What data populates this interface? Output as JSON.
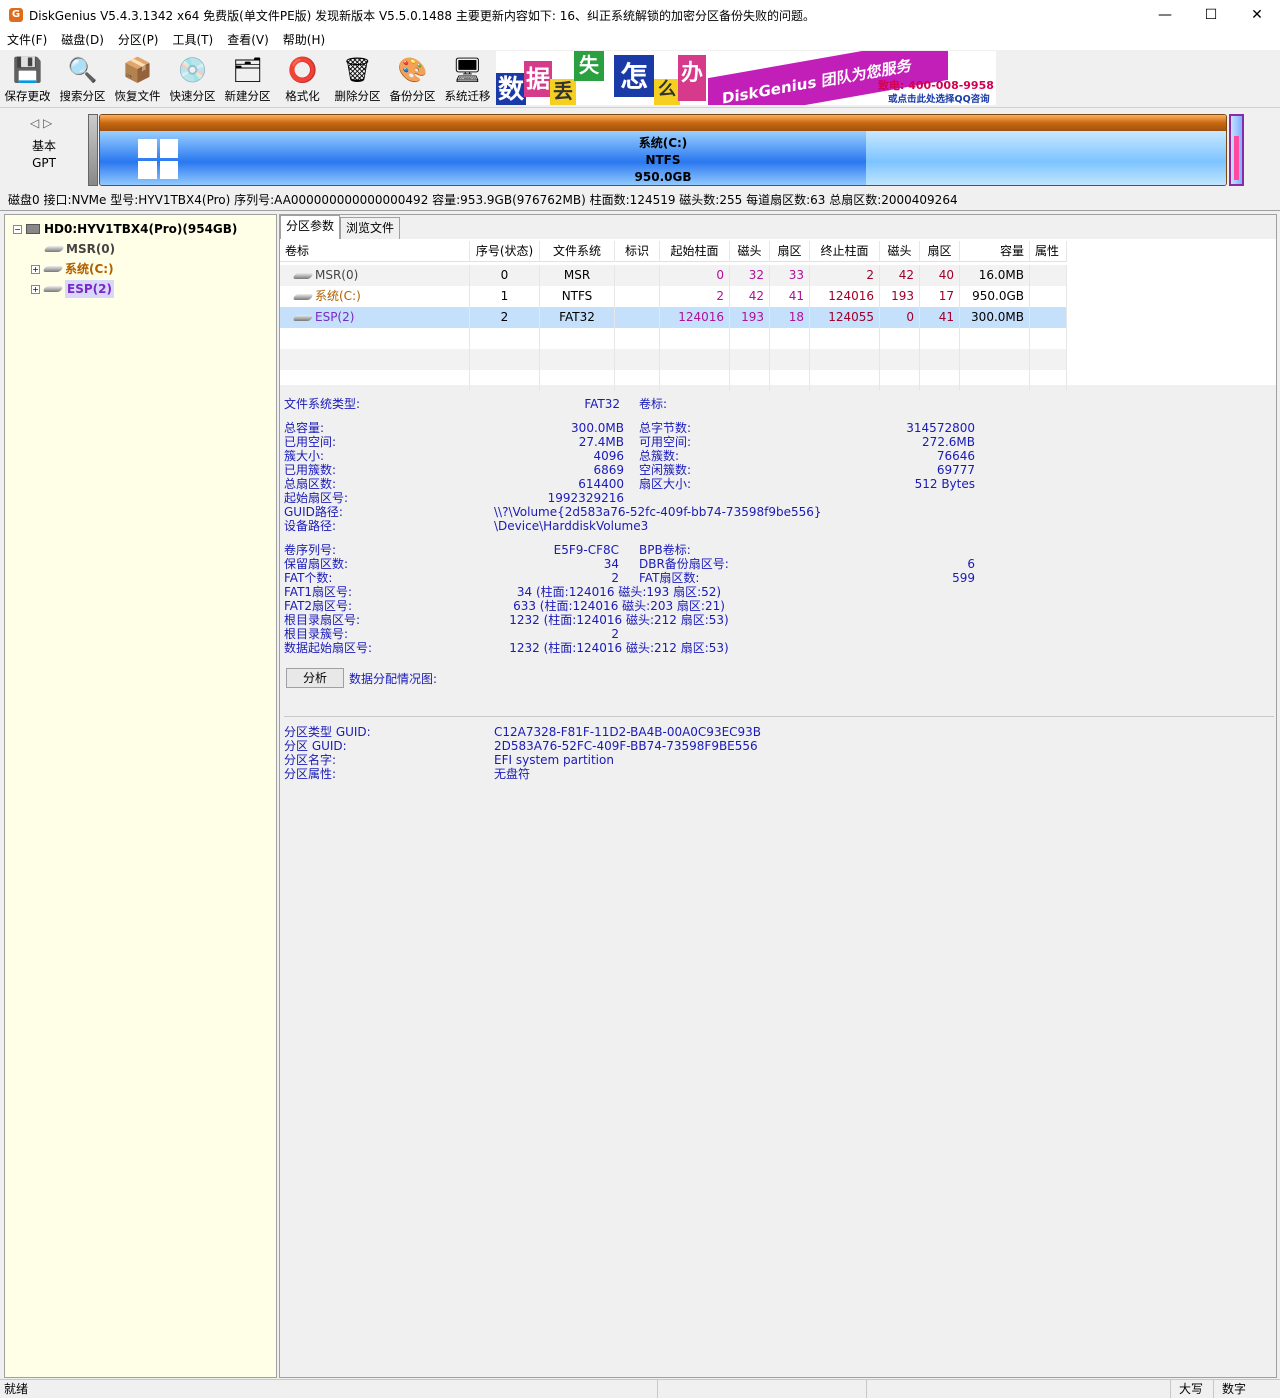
{
  "window": {
    "title": "DiskGenius V5.4.3.1342 x64 免费版(单文件PE版)   发现新版本 V5.5.0.1488    主要更新内容如下: 16、纠正系统解锁的加密分区备份失败的问题。",
    "app_icon": "G",
    "minimize": "—",
    "maximize": "☐",
    "close": "✕"
  },
  "menu": [
    "文件(F)",
    "磁盘(D)",
    "分区(P)",
    "工具(T)",
    "查看(V)",
    "帮助(H)"
  ],
  "toolbar": [
    {
      "label": "保存更改",
      "icon": "save-icon",
      "glyph": "💾"
    },
    {
      "label": "搜索分区",
      "icon": "search-icon",
      "glyph": "🔍"
    },
    {
      "label": "恢复文件",
      "icon": "recover-icon",
      "glyph": "📦"
    },
    {
      "label": "快速分区",
      "icon": "quick-partition-icon",
      "glyph": "💿"
    },
    {
      "label": "新建分区",
      "icon": "new-partition-icon",
      "glyph": "🗂"
    },
    {
      "label": "格式化",
      "icon": "format-icon",
      "glyph": "⭕"
    },
    {
      "label": "删除分区",
      "icon": "delete-icon",
      "glyph": "🗑"
    },
    {
      "label": "备份分区",
      "icon": "backup-icon",
      "glyph": "🎨"
    },
    {
      "label": "系统迁移",
      "icon": "migrate-icon",
      "glyph": "🖥"
    }
  ],
  "banner": {
    "chars": [
      "数",
      "据",
      "丢",
      "失",
      "怎",
      "么",
      "办"
    ],
    "slogan": "DiskGenius 团队为您服务",
    "phone": "致电: 400-008-9958",
    "qq": "或点击此处选择QQ咨询"
  },
  "disk_panel": {
    "nav": "◁ ▷",
    "type_line1": "基本",
    "type_line2": "GPT",
    "partition_name": "系统(C:)",
    "partition_fs": "NTFS",
    "partition_size": "950.0GB",
    "used_fraction": 0.68
  },
  "disk_info": "磁盘0 接口:NVMe  型号:HYV1TBX4(Pro)  序列号:AA000000000000000492  容量:953.9GB(976762MB)  柱面数:124519  磁头数:255  每道扇区数:63  总扇区数:2000409264",
  "tree": {
    "disk": "HD0:HYV1TBX4(Pro)(954GB)",
    "expander_minus": "−",
    "expander_plus": "+",
    "items": [
      "MSR(0)",
      "系统(C:)",
      "ESP(2)"
    ]
  },
  "tabs": [
    "分区参数",
    "浏览文件"
  ],
  "table": {
    "headers": [
      "卷标",
      "序号(状态)",
      "文件系统",
      "标识",
      "起始柱面",
      "磁头",
      "扇区",
      "终止柱面",
      "磁头",
      "扇区",
      "容量",
      "属性"
    ],
    "rows": [
      [
        "MSR(0)",
        "0",
        "MSR",
        "",
        "0",
        "32",
        "33",
        "2",
        "42",
        "40",
        "16.0MB",
        ""
      ],
      [
        "系统(C:)",
        "1",
        "NTFS",
        "",
        "2",
        "42",
        "41",
        "124016",
        "193",
        "17",
        "950.0GB",
        ""
      ],
      [
        "ESP(2)",
        "2",
        "FAT32",
        "",
        "124016",
        "193",
        "18",
        "124055",
        "0",
        "41",
        "300.0MB",
        ""
      ]
    ]
  },
  "details": {
    "fs_type_label": "文件系统类型:",
    "fs_type": "FAT32",
    "volume_label_label": "卷标:",
    "left1": [
      [
        "总容量:",
        "300.0MB"
      ],
      [
        "已用空间:",
        "27.4MB"
      ],
      [
        "簇大小:",
        "4096"
      ],
      [
        "已用簇数:",
        "6869"
      ],
      [
        "总扇区数:",
        "614400"
      ],
      [
        "起始扇区号:",
        "1992329216"
      ]
    ],
    "right1": [
      [
        "总字节数:",
        "314572800"
      ],
      [
        "可用空间:",
        "272.6MB"
      ],
      [
        "总簇数:",
        "76646"
      ],
      [
        "空闲簇数:",
        "69777"
      ],
      [
        "扇区大小:",
        "512 Bytes"
      ]
    ],
    "guid_path_label": "GUID路径:",
    "guid_path": "\\\\?\\Volume{2d583a76-52fc-409f-bb74-73598f9be556}",
    "device_path_label": "设备路径:",
    "device_path": "\\Device\\HarddiskVolume3",
    "left2": [
      [
        "卷序列号:",
        "E5F9-CF8C"
      ],
      [
        "保留扇区数:",
        "34"
      ],
      [
        "FAT个数:",
        "2"
      ],
      [
        "FAT1扇区号:",
        "34 (柱面:124016 磁头:193 扇区:52)"
      ],
      [
        "FAT2扇区号:",
        "633 (柱面:124016 磁头:203 扇区:21)"
      ],
      [
        "根目录扇区号:",
        "1232 (柱面:124016 磁头:212 扇区:53)"
      ],
      [
        "根目录簇号:",
        "2"
      ],
      [
        "数据起始扇区号:",
        "1232 (柱面:124016 磁头:212 扇区:53)"
      ]
    ],
    "right2": [
      [
        "BPB卷标:",
        ""
      ],
      [
        "DBR备份扇区号:",
        "6"
      ],
      [
        "FAT扇区数:",
        "599"
      ]
    ],
    "analyze_button": "分析",
    "allocation_label": "数据分配情况图:",
    "guid_block": [
      [
        "分区类型 GUID:",
        "C12A7328-F81F-11D2-BA4B-00A0C93EC93B"
      ],
      [
        "分区 GUID:",
        "2D583A76-52FC-409F-BB74-73598F9BE556"
      ],
      [
        "分区名字:",
        "EFI system partition"
      ],
      [
        "分区属性:",
        "无盘符"
      ]
    ]
  },
  "status": {
    "ready": "就绪",
    "caps": "大写",
    "num": "数字"
  }
}
